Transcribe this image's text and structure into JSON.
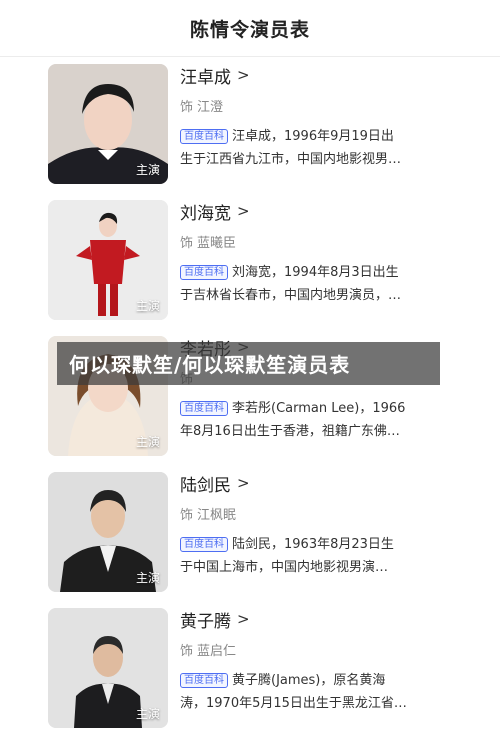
{
  "header": {
    "title": "陈情令演员表"
  },
  "badge_label": "百度百科",
  "role_prefix": "饰",
  "banner": {
    "text": "何以琛默笙/何以琛默笙演员表"
  },
  "actors": [
    {
      "name": "汪卓成",
      "role": "江澄",
      "tag": "主演",
      "line1": "汪卓成，1996年9月19日出",
      "line2": "生于江西省九江市，中国内地影视男…"
    },
    {
      "name": "刘海宽",
      "role": "蓝曦臣",
      "tag": "主演",
      "line1": "刘海宽，1994年8月3日出生",
      "line2": "于吉林省长春市，中国内地男演员，…"
    },
    {
      "name": "李若彤",
      "role": "",
      "tag": "主演",
      "line1": "李若彤(Carman Lee)，1966",
      "line2": "年8月16日出生于香港，祖籍广东佛…"
    },
    {
      "name": "陆剑民",
      "role": "江枫眠",
      "tag": "主演",
      "line1": "陆剑民，1963年8月23日生",
      "line2": "于中国上海市，中国内地影视男演…"
    },
    {
      "name": "黄子腾",
      "role": "蓝启仁",
      "tag": "主演",
      "line1": "黄子腾(James)，原名黄海",
      "line2": "涛，1970年5月15日出生于黑龙江省…"
    }
  ],
  "colors": {
    "accent": "#4e6ef2",
    "text": "#222222",
    "muted": "#888888"
  }
}
